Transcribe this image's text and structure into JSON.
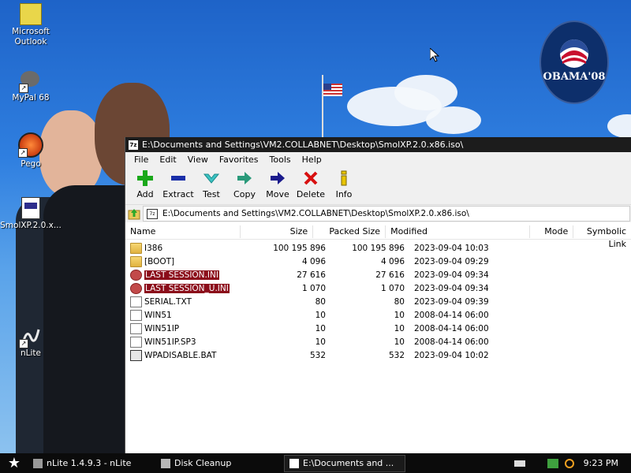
{
  "desktop": {
    "icons": [
      {
        "label": "Microsoft Outlook"
      },
      {
        "label": "MyPal 68"
      },
      {
        "label": "Pego"
      },
      {
        "label": "SmolXP.2.0.x..."
      },
      {
        "label": "nLite"
      }
    ],
    "badge_text": "OBAMA'08"
  },
  "window": {
    "title": "E:\\Documents and Settings\\VM2.COLLABNET\\Desktop\\SmolXP.2.0.x86.iso\\",
    "menu": [
      "File",
      "Edit",
      "View",
      "Favorites",
      "Tools",
      "Help"
    ],
    "toolbar": {
      "add": "Add",
      "extract": "Extract",
      "test": "Test",
      "copy": "Copy",
      "move": "Move",
      "delete": "Delete",
      "info": "Info"
    },
    "address": "E:\\Documents and Settings\\VM2.COLLABNET\\Desktop\\SmolXP.2.0.x86.iso\\",
    "columns": {
      "name": "Name",
      "size": "Size",
      "packed": "Packed Size",
      "modified": "Modified",
      "mode": "Mode",
      "symlink": "Symbolic Link"
    },
    "files": [
      {
        "name": "I386",
        "size": "100 195 896",
        "packed": "100 195 896",
        "modified": "2023-09-04 10:03",
        "icon": "folder-icon"
      },
      {
        "name": "[BOOT]",
        "size": "4 096",
        "packed": "4 096",
        "modified": "2023-09-04 09:29",
        "icon": "folder-icon"
      },
      {
        "name": "LAST SESSION.INI",
        "size": "27 616",
        "packed": "27 616",
        "modified": "2023-09-04 09:34",
        "icon": "ini-file-icon"
      },
      {
        "name": "LAST SESSION_U.INI",
        "size": "1 070",
        "packed": "1 070",
        "modified": "2023-09-04 09:34",
        "icon": "ini-file-icon"
      },
      {
        "name": "SERIAL.TXT",
        "size": "80",
        "packed": "80",
        "modified": "2023-09-04 09:39",
        "icon": "text-file-icon"
      },
      {
        "name": "WIN51",
        "size": "10",
        "packed": "10",
        "modified": "2008-04-14 06:00",
        "icon": "file-icon"
      },
      {
        "name": "WIN51IP",
        "size": "10",
        "packed": "10",
        "modified": "2008-04-14 06:00",
        "icon": "file-icon"
      },
      {
        "name": "WIN51IP.SP3",
        "size": "10",
        "packed": "10",
        "modified": "2008-04-14 06:00",
        "icon": "file-icon"
      },
      {
        "name": "WPADISABLE.BAT",
        "size": "532",
        "packed": "532",
        "modified": "2023-09-04 10:02",
        "icon": "batch-file-icon"
      }
    ]
  },
  "taskbar": {
    "tasks": [
      {
        "label": "nLite 1.4.9.3 - nLite"
      },
      {
        "label": "Disk Cleanup"
      },
      {
        "label": "E:\\Documents and ..."
      }
    ],
    "clock": "9:23 PM"
  },
  "colors": {
    "selection": "#8b0d1a",
    "titlebar": "#1c1c1c",
    "taskbar": "#0b0b0b"
  }
}
